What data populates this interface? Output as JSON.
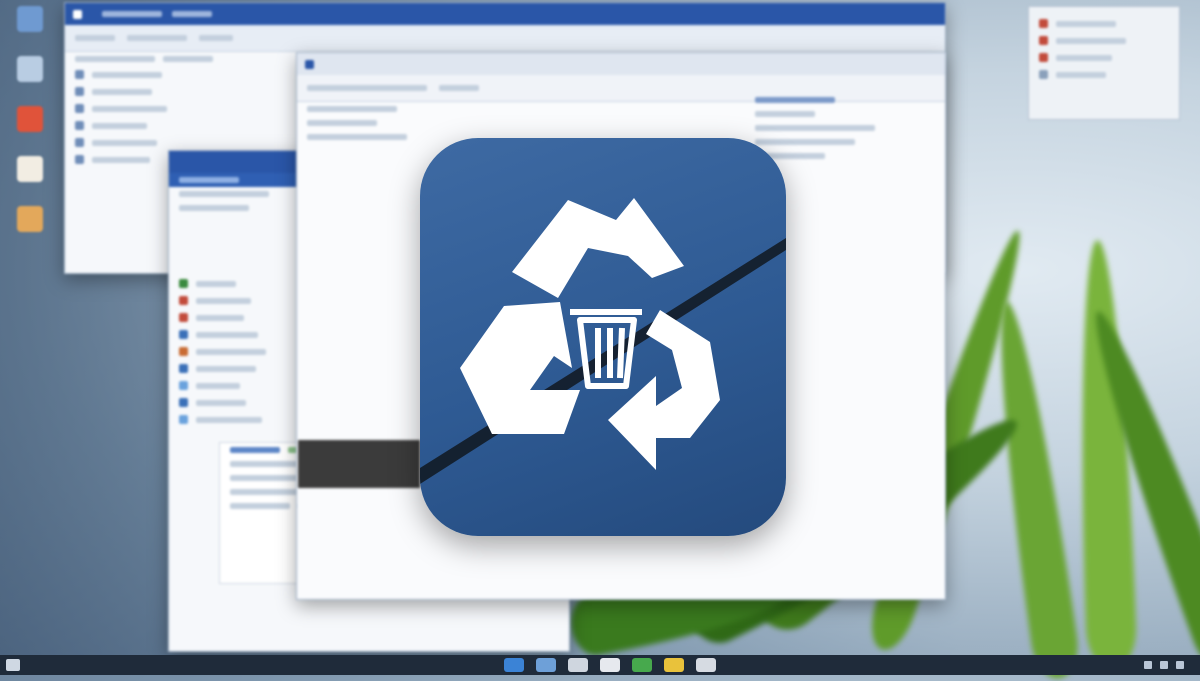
{
  "app_icon": {
    "name": "recycle-bin-app-icon",
    "colors": {
      "background_top": "#3e6aa3",
      "background_bottom": "#244a7d",
      "symbol": "#ffffff",
      "crack": "#101820"
    },
    "symbol": "recycle-arrows-with-trash-can"
  },
  "desktop": {
    "icons": [
      {
        "name": "desktop-icon-1",
        "color": "#6f9ad1",
        "label": ""
      },
      {
        "name": "desktop-icon-2",
        "color": "#b9cde3",
        "label": ""
      },
      {
        "name": "desktop-icon-3",
        "color": "#e0533a",
        "label": ""
      },
      {
        "name": "desktop-icon-4",
        "color": "#f2ede3",
        "label": ""
      },
      {
        "name": "desktop-icon-5",
        "color": "#e3a85b",
        "label": ""
      }
    ]
  },
  "windows": {
    "back": {
      "title": "",
      "accent": "#2a56a8"
    },
    "middle": {
      "title": "",
      "accent": "#2a56a8"
    },
    "front": {
      "title": "",
      "accent": "#2a56a8"
    }
  },
  "taskbar": {
    "background": "#1f2b3a",
    "apps": [
      {
        "name": "taskbar-app-1",
        "color": "#3b83d6"
      },
      {
        "name": "taskbar-app-2",
        "color": "#6ea0d8"
      },
      {
        "name": "taskbar-app-3",
        "color": "#cfd6df"
      },
      {
        "name": "taskbar-app-4",
        "color": "#e6e9ee"
      },
      {
        "name": "taskbar-app-5",
        "color": "#47a94d"
      },
      {
        "name": "taskbar-app-6",
        "color": "#e9c23b"
      },
      {
        "name": "taskbar-app-7",
        "color": "#d6dbe2"
      }
    ],
    "clock_time": "",
    "clock_date": ""
  },
  "notifications_widget": {
    "title": ""
  }
}
